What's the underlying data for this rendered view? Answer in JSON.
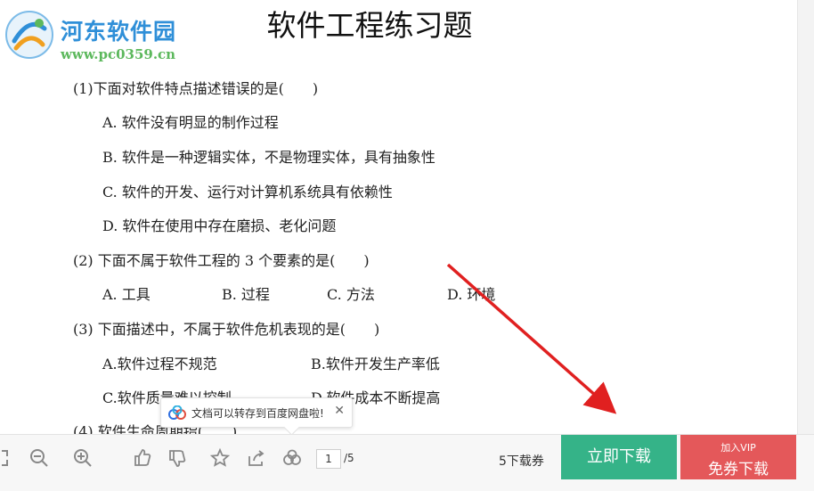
{
  "watermark": {
    "name": "河东软件园",
    "url": "www.pc0359.cn"
  },
  "document": {
    "title": "软件工程练习题",
    "questions": [
      {
        "text": "(1)下面对软件特点描述错误的是(　　)",
        "options": [
          "A. 软件没有明显的制作过程",
          "B. 软件是一种逻辑实体，不是物理实体，具有抽象性",
          "C. 软件的开发、运行对计算机系统具有依赖性",
          "D. 软件在使用中存在磨损、老化问题"
        ]
      },
      {
        "text": "(2) 下面不属于软件工程的 3 个要素的是(　　)",
        "options": [
          "A. 工具",
          "B. 过程",
          "C. 方法",
          "D. 环境"
        ]
      },
      {
        "text": "(3) 下面描述中，不属于软件危机表现的是(　　)",
        "options": [
          "A.软件过程不规范",
          "B.软件开发生产率低",
          "C.软件质量难以控制",
          "D.软件成本不断提高"
        ]
      },
      {
        "text": "(4) 软件生命周期指(　　)",
        "options": []
      }
    ]
  },
  "toast": {
    "text": "文档可以转存到百度网盘啦!",
    "close": "✕"
  },
  "toolbar": {
    "current_page": "1",
    "total_pages": "/5",
    "coupon": "5下载券",
    "download_label": "立即下载",
    "vip_top": "加入VIP",
    "vip_label": "免券下载"
  },
  "colors": {
    "download": "#35b388",
    "vip": "#e4585a",
    "arrow": "#e02020",
    "watermark": "#2f8fd8"
  }
}
